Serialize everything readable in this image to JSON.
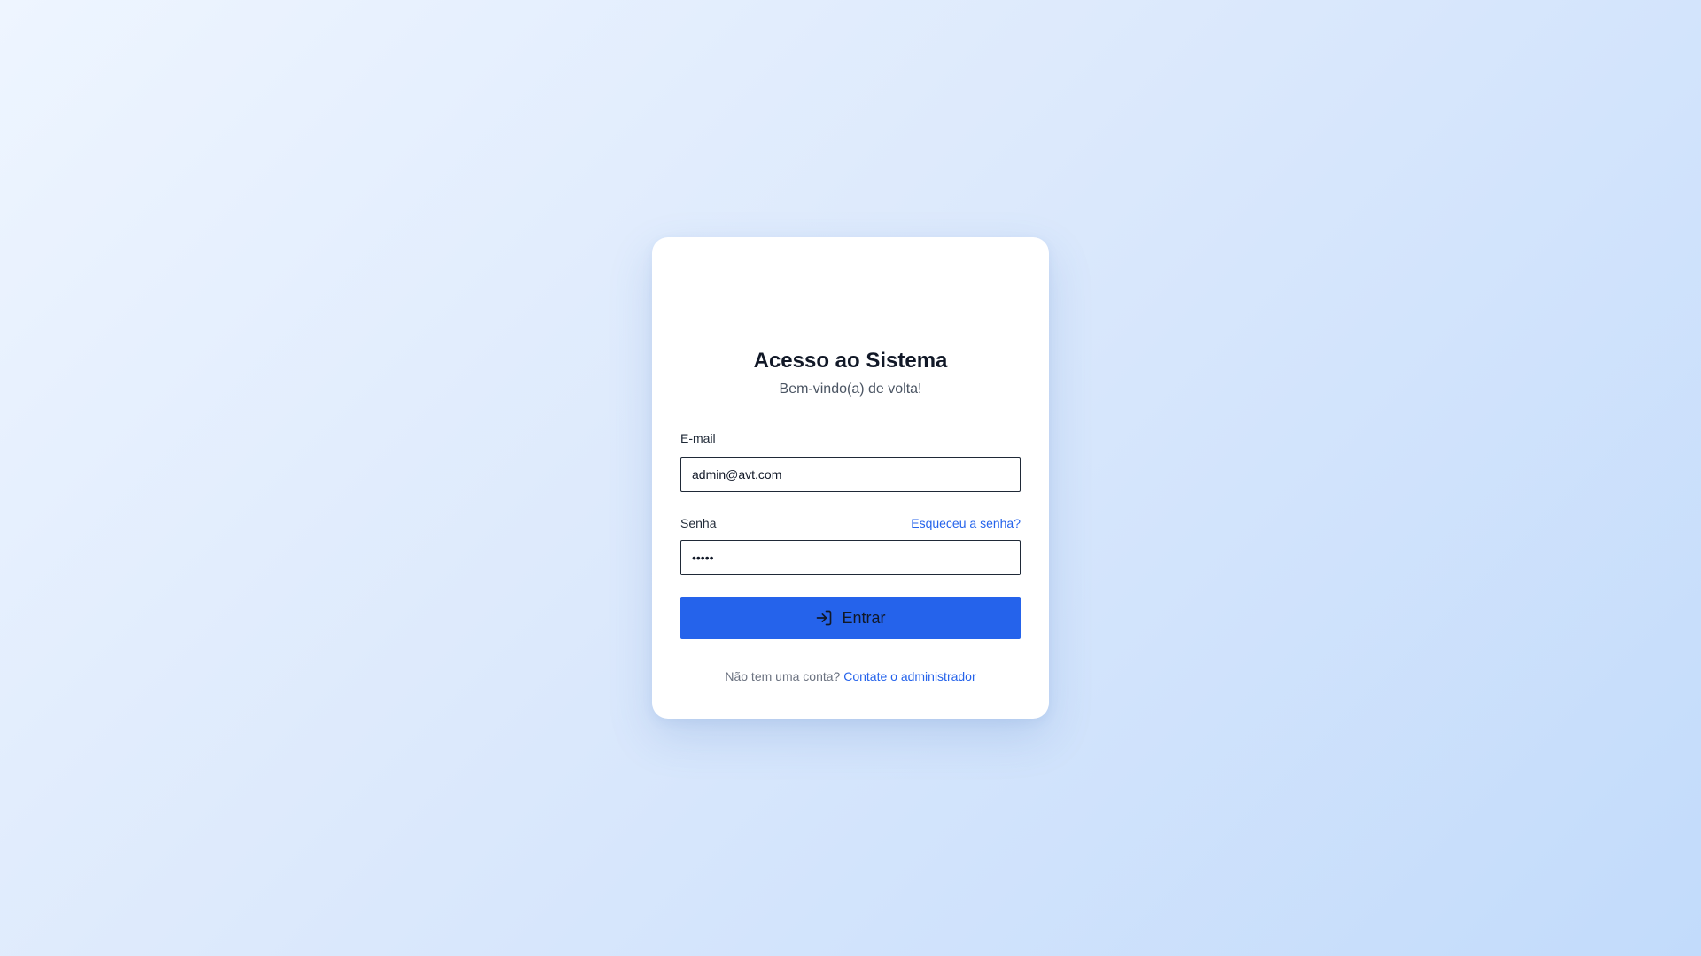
{
  "login": {
    "title": "Acesso ao Sistema",
    "subtitle": "Bem-vindo(a) de volta!",
    "email": {
      "label": "E-mail",
      "value": "admin@avt.com"
    },
    "password": {
      "label": "Senha",
      "value": "•••••",
      "forgot_link": "Esqueceu a senha?"
    },
    "submit": {
      "label": "Entrar",
      "icon": "login-icon"
    },
    "footer": {
      "text": "Não tem uma conta?",
      "link": "Contate o administrador"
    }
  },
  "colors": {
    "accent": "#2563eb",
    "title": "#111827",
    "muted": "#6b7280"
  }
}
